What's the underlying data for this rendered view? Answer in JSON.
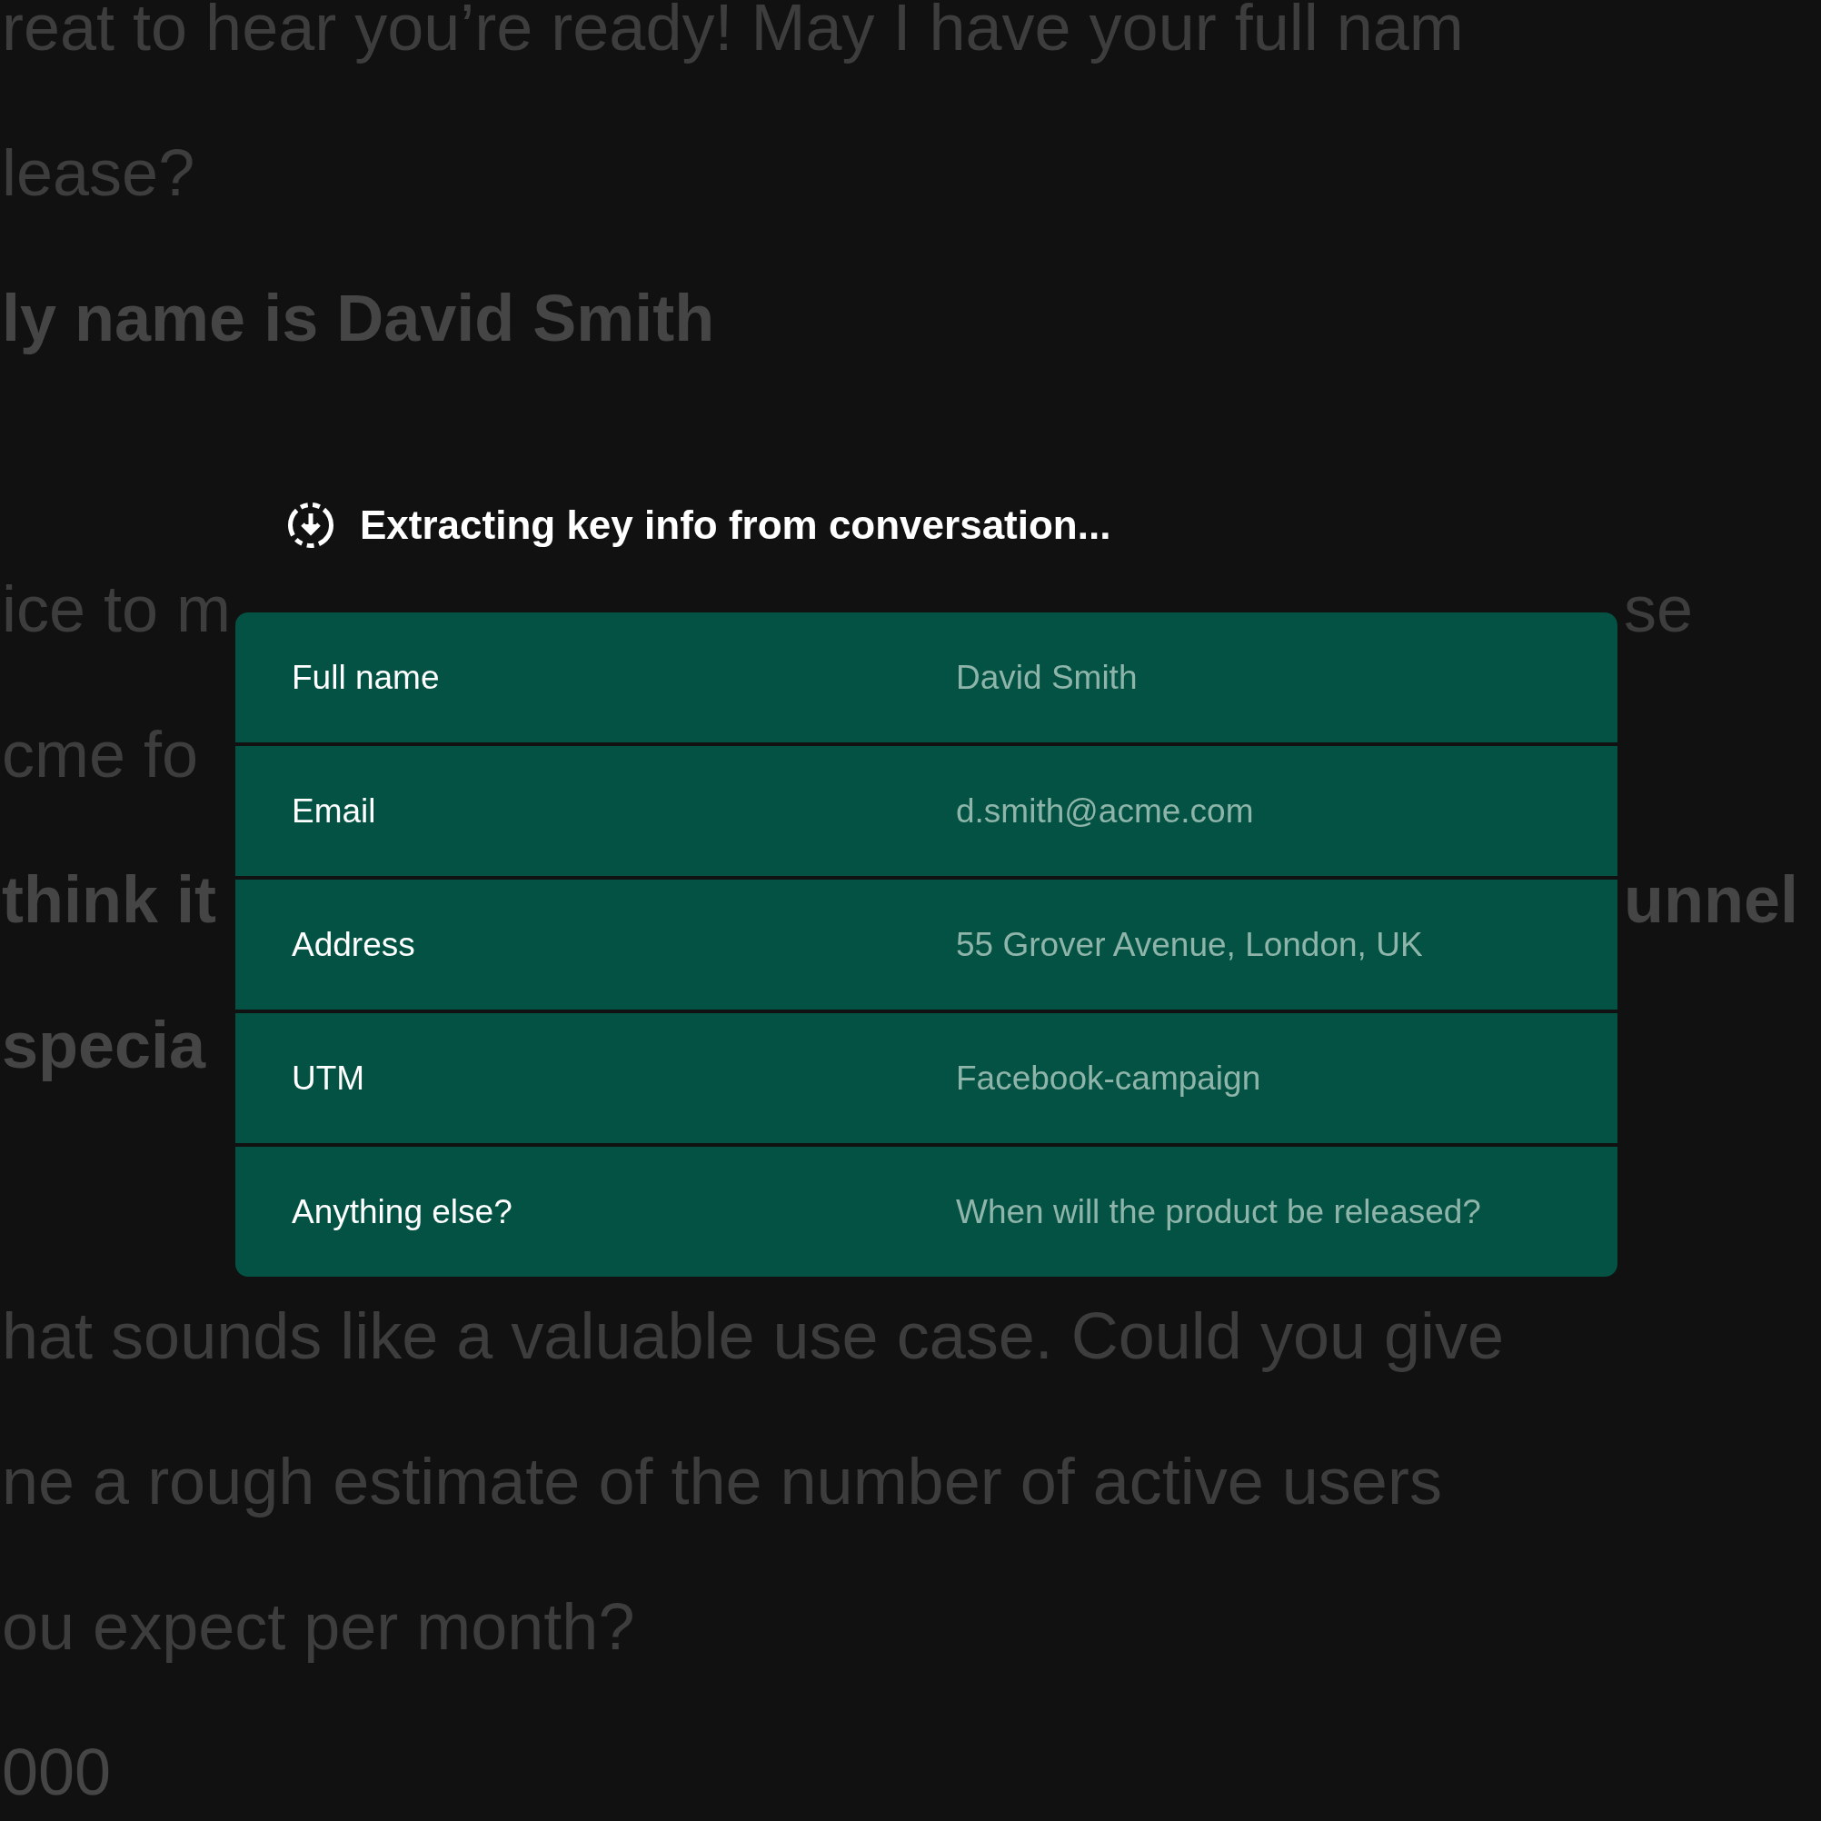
{
  "background_blocks": [
    {
      "lines": [
        {
          "kind": "agent",
          "text": "reat to hear you’re ready! May I have your full nam"
        },
        {
          "kind": "agent",
          "text": "lease?"
        },
        {
          "kind": "user",
          "text": "ly name is David Smith"
        }
      ]
    },
    {
      "lines": [
        {
          "kind": "agent",
          "text": "ice to m",
          "text_right": "se"
        },
        {
          "kind": "agent",
          "text": "cme fo"
        },
        {
          "kind": "user",
          "text": "think it",
          "text_right": "unnel"
        },
        {
          "kind": "user",
          "text": "specia"
        }
      ]
    },
    {
      "lines": [
        {
          "kind": "agent",
          "text": "hat sounds like a valuable use case. Could you give"
        },
        {
          "kind": "agent",
          "text": "ne a rough estimate of the number of active users"
        },
        {
          "kind": "agent",
          "text": "ou expect per month?"
        },
        {
          "kind": "reply",
          "text": "000"
        }
      ]
    }
  ],
  "overlay": {
    "title": "Extracting key info from conversation...",
    "fields": [
      {
        "label": "Full name",
        "value": "David Smith"
      },
      {
        "label": "Email",
        "value": "d.smith@acme.com"
      },
      {
        "label": "Address",
        "value": "55 Grover Avenue, London, UK"
      },
      {
        "label": "UTM",
        "value": "Facebook-campaign"
      },
      {
        "label": "Anything else?",
        "value": "When will the product be released?"
      }
    ]
  }
}
